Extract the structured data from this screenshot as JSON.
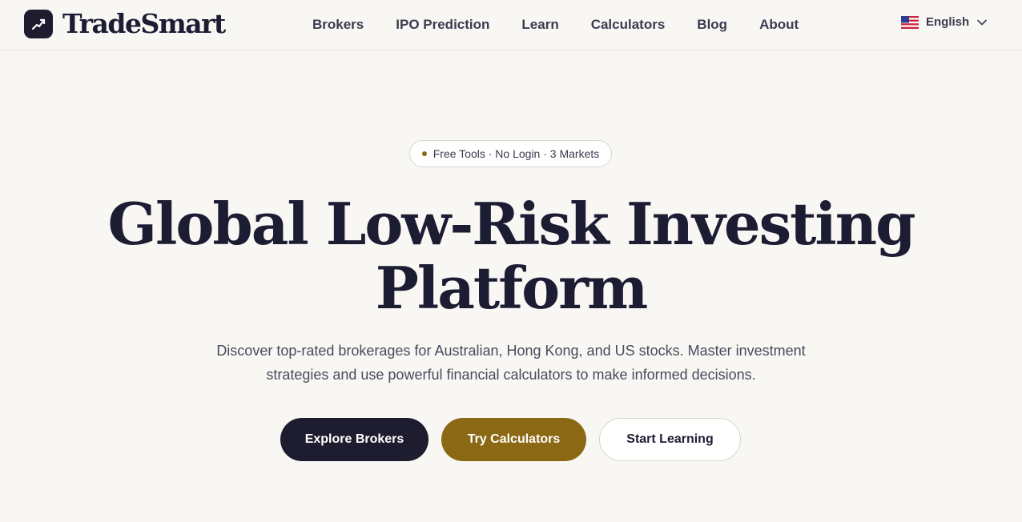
{
  "header": {
    "brand": "TradeSmart",
    "nav": [
      {
        "label": "Brokers"
      },
      {
        "label": "IPO Prediction"
      },
      {
        "label": "Learn"
      },
      {
        "label": "Calculators"
      },
      {
        "label": "Blog"
      },
      {
        "label": "About"
      }
    ],
    "language": {
      "label": "English",
      "flag_icon": "us-flag-icon"
    }
  },
  "hero": {
    "badge": "Free Tools · No Login · 3 Markets",
    "title_line1": "Global Low-Risk Investing",
    "title_line2": "Platform",
    "subtitle_line1": "Discover top-rated brokerages for Australian, Hong Kong, and US stocks. Master investment",
    "subtitle_line2": "strategies and use powerful financial calculators to make informed decisions.",
    "buttons": {
      "explore": "Explore Brokers",
      "calculators": "Try Calculators",
      "learning": "Start Learning"
    }
  },
  "colors": {
    "dark": "#1e1d30",
    "gold": "#8b6914",
    "background": "#f8f7f4"
  }
}
